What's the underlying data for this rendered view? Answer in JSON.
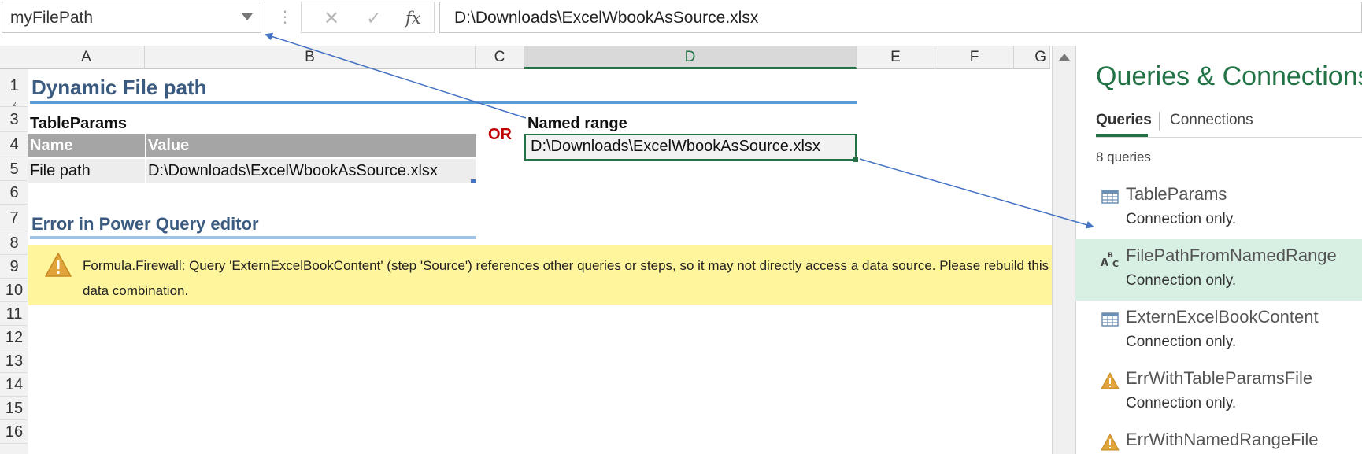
{
  "formula_bar": {
    "name_box": "myFilePath",
    "cancel_glyph": "✕",
    "enter_glyph": "✓",
    "fx_label": "fx",
    "formula": "D:\\Downloads\\ExcelWbookAsSource.xlsx"
  },
  "columns": [
    "A",
    "B",
    "C",
    "D",
    "E",
    "F",
    "G"
  ],
  "selected_column": "D",
  "rows": [
    "1",
    "2",
    "3",
    "4",
    "5",
    "6",
    "7",
    "8",
    "9",
    "10",
    "11",
    "12",
    "13",
    "14",
    "15",
    "16"
  ],
  "sheet": {
    "title": "Dynamic File path",
    "table_label": "TableParams",
    "table_headers": [
      "Name",
      "Value"
    ],
    "table_row": [
      "File path",
      "D:\\Downloads\\ExcelWbookAsSource.xlsx"
    ],
    "or_label": "OR",
    "named_range_label": "Named range",
    "named_range_value": "D:\\Downloads\\ExcelWbookAsSource.xlsx",
    "error_title": "Error in Power Query editor",
    "error_message": "Formula.Firewall: Query 'ExternExcelBookContent' (step 'Source') references other queries or steps, so it may not directly access a data source. Please rebuild this data combination."
  },
  "pane": {
    "title": "Queries & Connections",
    "tabs": [
      "Queries",
      "Connections"
    ],
    "active_tab": "Queries",
    "count_label": "8 queries",
    "queries": [
      {
        "name": "TableParams",
        "status": "Connection only.",
        "icon": "table-icon"
      },
      {
        "name": "FilePathFromNamedRange",
        "status": "Connection only.",
        "icon": "text-type-icon"
      },
      {
        "name": "ExternExcelBookContent",
        "status": "Connection only.",
        "icon": "table-icon"
      },
      {
        "name": "ErrWithTableParamsFile",
        "status": "Connection only.",
        "icon": "warning-icon"
      },
      {
        "name": "ErrWithNamedRangeFile",
        "status": "",
        "icon": "warning-icon"
      }
    ],
    "selected_query": "FilePathFromNamedRange"
  },
  "colors": {
    "excel_green": "#217346",
    "title_blue": "#3a5a80",
    "error_fill": "#fff59d",
    "or_red": "#c00000",
    "arrow_blue": "#4472c4"
  }
}
